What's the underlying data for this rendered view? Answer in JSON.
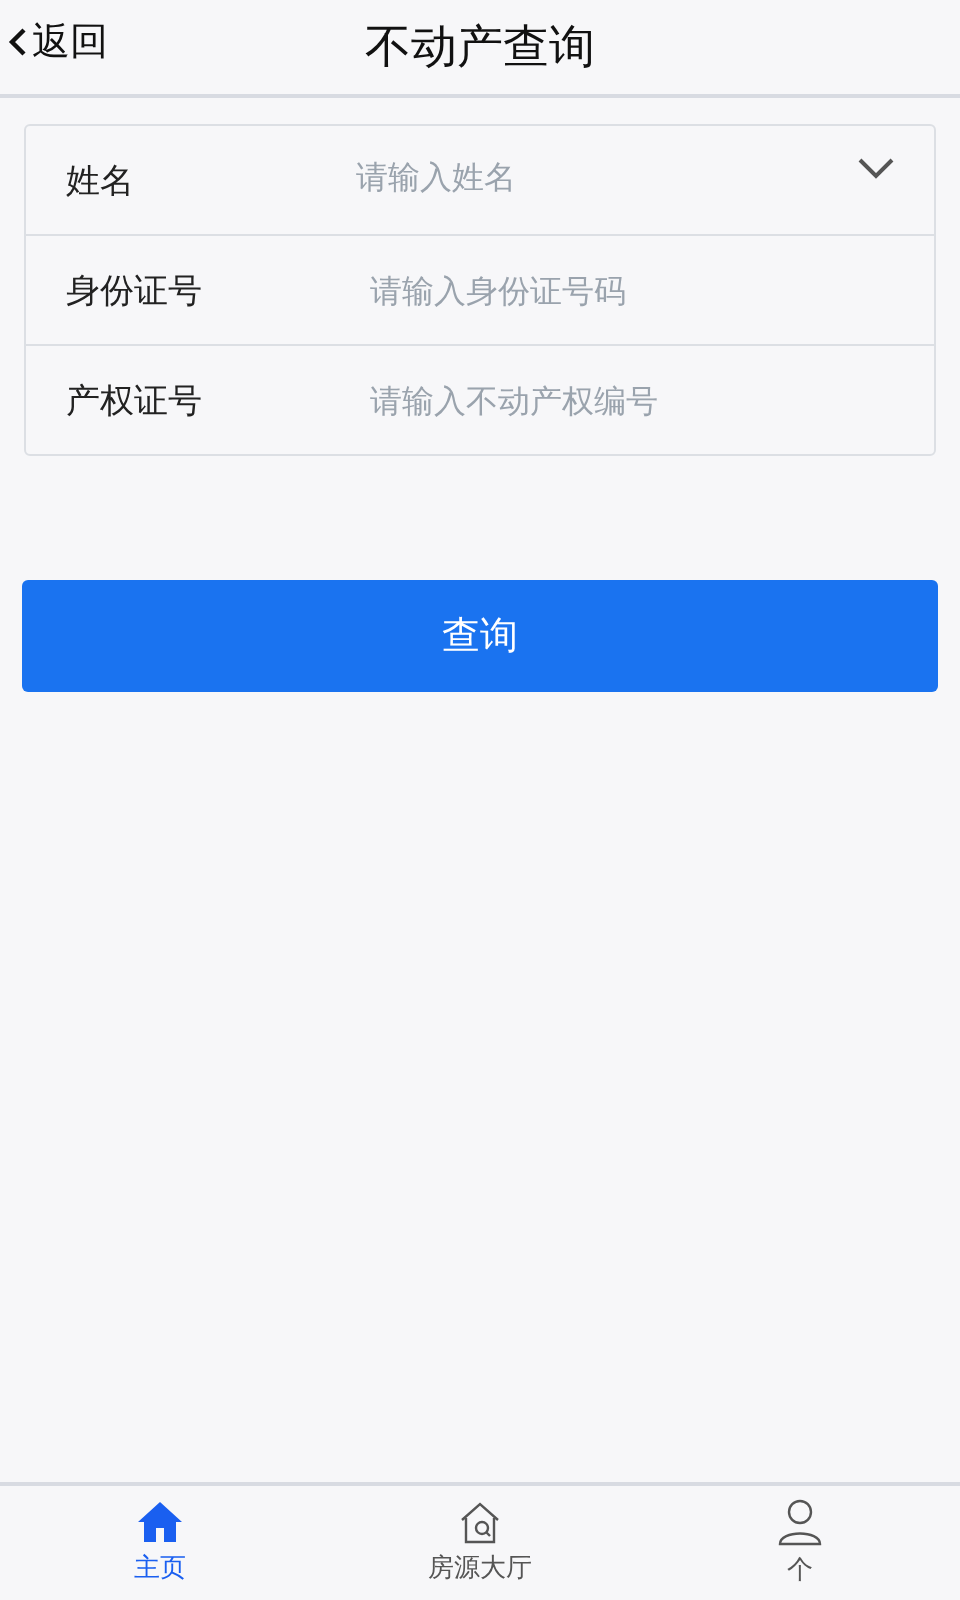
{
  "header": {
    "back_label": "返回",
    "title": "不动产查询"
  },
  "form": {
    "fields": [
      {
        "kind": "dropdown",
        "label": "姓名",
        "placeholder": "请输入姓名"
      },
      {
        "kind": "text",
        "label": "身份证号",
        "placeholder": "请输入身份证号码"
      },
      {
        "kind": "text",
        "label": "产权证号",
        "placeholder": "请输入不动产权编号"
      }
    ]
  },
  "submit_button": "查询",
  "tab_bar": [
    {
      "kind": "home",
      "label": "主页",
      "selected": true
    },
    {
      "kind": "house-search",
      "label": "房源大厅",
      "selected": false
    },
    {
      "kind": "person",
      "label": "个",
      "selected": false
    }
  ]
}
